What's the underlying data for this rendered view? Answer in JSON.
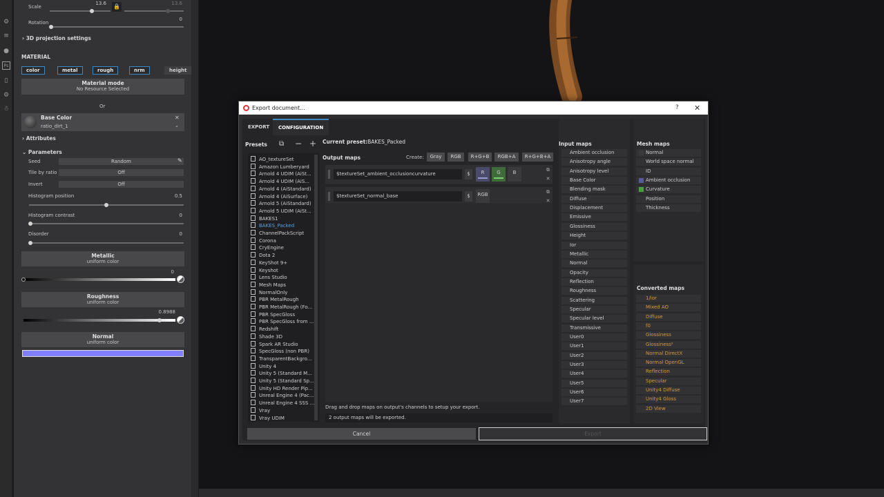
{
  "props": {
    "scale_label": "Scale",
    "scale_value": "13.6",
    "scale_value2": "13.6",
    "rotation_label": "Rotation",
    "rotation_value": "0",
    "projection_settings": "3D projection settings",
    "material_header": "MATERIAL",
    "channels": [
      "color",
      "metal",
      "rough",
      "nrm",
      "height"
    ],
    "material_mode_title": "Material mode",
    "material_mode_sub": "No Resource Selected",
    "or_label": "Or",
    "base_color_title": "Base Color",
    "base_color_resource": "ratio_dirt_1",
    "attributes_header": "Attributes",
    "parameters_header": "Parameters",
    "seed_label": "Seed",
    "seed_value": "Random",
    "tile_label": "Tile by ratio",
    "tile_value": "Off",
    "invert_label": "Invert",
    "invert_value": "Off",
    "hist_pos_label": "Histogram position",
    "hist_pos_value": "0.5",
    "hist_contrast_label": "Histogram contrast",
    "hist_contrast_value": "0",
    "disorder_label": "Disorder",
    "disorder_value": "0",
    "metallic_title": "Metallic",
    "metallic_sub": "uniform color",
    "metallic_value": "0",
    "roughness_title": "Roughness",
    "roughness_sub": "uniform color",
    "roughness_value": "0.8988",
    "normal_title": "Normal",
    "normal_sub": "uniform color",
    "normal_color": "#8080ff"
  },
  "dialog": {
    "title": "Export document...",
    "help": "?",
    "close": "✕",
    "tabs": [
      "EXPORT",
      "CONFIGURATION"
    ],
    "presets_header": "Presets",
    "current_preset_label": "Current preset:",
    "current_preset_value": "BAKES_Packed",
    "output_maps_header": "Output maps",
    "create_label": "Create:",
    "create_buttons": [
      "Gray",
      "RGB",
      "R+G+B",
      "RGB+A",
      "R+G+B+A"
    ],
    "presets": [
      "AO_textureSet",
      "Amazon Lumberyard",
      "Arnold 4  UDIM (AiSt...",
      "Arnold 4  UDIM (AiS...",
      "Arnold 4 (AiStandard)",
      "Arnold 4 (AiSurface)",
      "Arnold 5 (AiStandard)",
      "Arnold 5 UDIM (AiSt...",
      "BAKES1",
      "BAKES_Packed",
      "ChannelPackScript",
      "Corona",
      "CryEngine",
      "Dota 2",
      "KeyShot 9+",
      "Keyshot",
      "Lens Studio",
      "Mesh Maps",
      "NormalOnly",
      "PBR MetalRough",
      "PBR MetalRough (Fo...",
      "PBR SpecGloss",
      "PBR SpecGloss from ...",
      "Redshift",
      "Shade 3D",
      "Spark AR Studio",
      "SpecGloss (non PBR)",
      "TransparentBackgro...",
      "Unity 4",
      "Unity 5 (Standard M...",
      "Unity 5 (Standard Sp...",
      "Unity HD Render Pip...",
      "Unreal Engine 4 (Pac...",
      "Unreal Engine 4 SSS ...",
      "Vray",
      "Vray UDIM"
    ],
    "selected_preset": "BAKES_Packed",
    "output_rows": [
      {
        "name": "$textureSet_ambient_occlusioncurvature",
        "dollar": "$",
        "channels": [
          "R",
          "G",
          "B"
        ]
      },
      {
        "name": "$textureSet_normal_base",
        "dollar": "$",
        "channels": [
          "RGB"
        ]
      }
    ],
    "hint": "Drag and drop maps on output's channels to setup your export.",
    "status": "2 output maps will be exported.",
    "input_maps_header": "Input maps",
    "input_maps": [
      "Ambient occlusion",
      "Anisotropy angle",
      "Anisotropy level",
      "Base Color",
      "Blending mask",
      "Diffuse",
      "Displacement",
      "Emissive",
      "Glossiness",
      "Height",
      "Ior",
      "Metallic",
      "Normal",
      "Opacity",
      "Reflection",
      "Roughness",
      "Scattering",
      "Specular",
      "Specular level",
      "Transmissive",
      "User0",
      "User1",
      "User2",
      "User3",
      "User4",
      "User5",
      "User6",
      "User7"
    ],
    "mesh_maps_header": "Mesh maps",
    "mesh_maps": [
      {
        "name": "Normal",
        "color": "#3a3a3d"
      },
      {
        "name": "World space normal",
        "color": ""
      },
      {
        "name": "ID",
        "color": ""
      },
      {
        "name": "Ambient occlusion",
        "color": "#5a5a9a"
      },
      {
        "name": "Curvature",
        "color": "#4aa040"
      },
      {
        "name": "Position",
        "color": ""
      },
      {
        "name": "Thickness",
        "color": ""
      }
    ],
    "converted_maps_header": "Converted maps",
    "converted_maps": [
      "1/ior",
      "Mixed AO",
      "Diffuse",
      "f0",
      "Glossiness",
      "Glossiness²",
      "Normal DirectX",
      "Normal OpenGL",
      "Reflection",
      "Specular",
      "Unity4 Diffuse",
      "Unity4 Gloss",
      "2D View"
    ],
    "cancel": "Cancel",
    "export": "Export"
  }
}
